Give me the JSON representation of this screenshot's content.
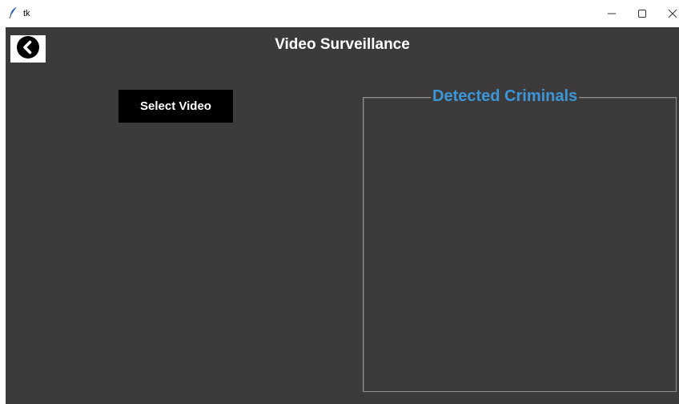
{
  "window": {
    "title": "tk",
    "icon": "feather-icon",
    "controls": {
      "minimize_icon": "minimize-icon",
      "maximize_icon": "maximize-icon",
      "close_icon": "close-icon"
    }
  },
  "header": {
    "back_icon": "chevron-left-circle-icon",
    "title": "Video Surveillance"
  },
  "main": {
    "select_video_label": "Select Video",
    "detected_panel_title": "Detected Criminals"
  },
  "colors": {
    "background": "#3c3a3b",
    "accent": "#3b97d8",
    "button": "#000000",
    "text": "#ffffff"
  }
}
